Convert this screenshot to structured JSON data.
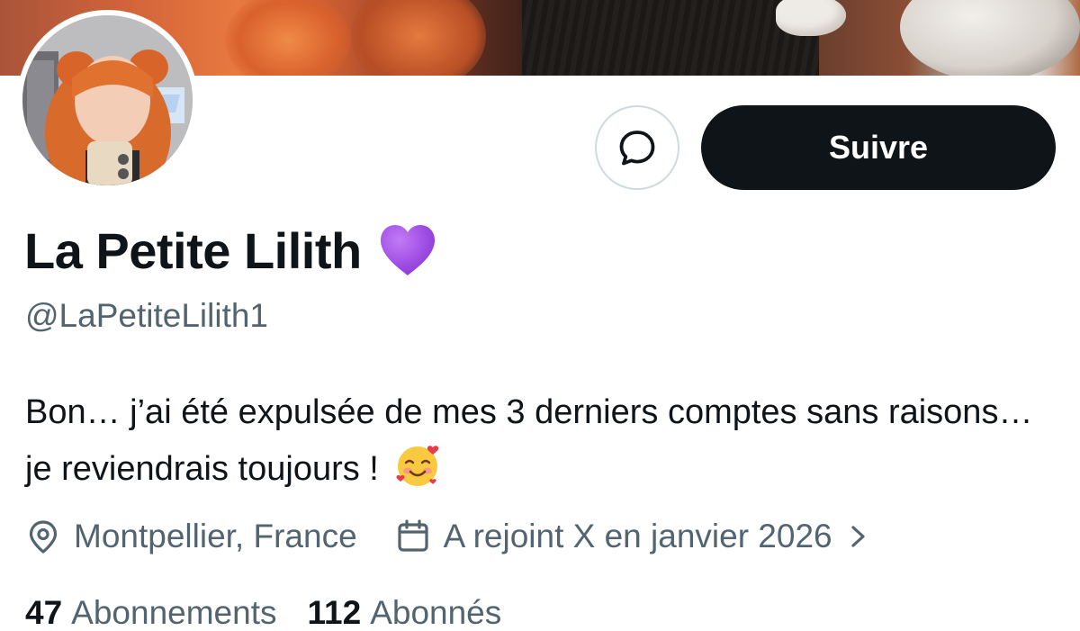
{
  "profile": {
    "display_name": "La Petite Lilith",
    "handle": "@LaPetiteLilith1",
    "bio": "Bon… j’ai été expulsée de mes 3 derniers comptes sans raisons… je reviendrais toujours !",
    "location": "Montpellier, France",
    "joined": "A rejoint X en janvier 2026",
    "following_count": "47",
    "following_label": "Abonnements",
    "followers_count": "112",
    "followers_label": "Abonnés"
  },
  "actions": {
    "follow_label": "Suivre",
    "message_icon": "message-icon"
  },
  "icons": {
    "name_emoji": "purple-heart-icon",
    "bio_emoji": "smiling-face-with-hearts-icon",
    "location": "location-pin-icon",
    "calendar": "calendar-icon",
    "chevron": "chevron-right-icon"
  },
  "colors": {
    "text_primary": "#0f1419",
    "text_secondary": "#536471",
    "button_bg": "#0f1419",
    "border": "#cfd9de",
    "heart": "#a95ee8"
  }
}
